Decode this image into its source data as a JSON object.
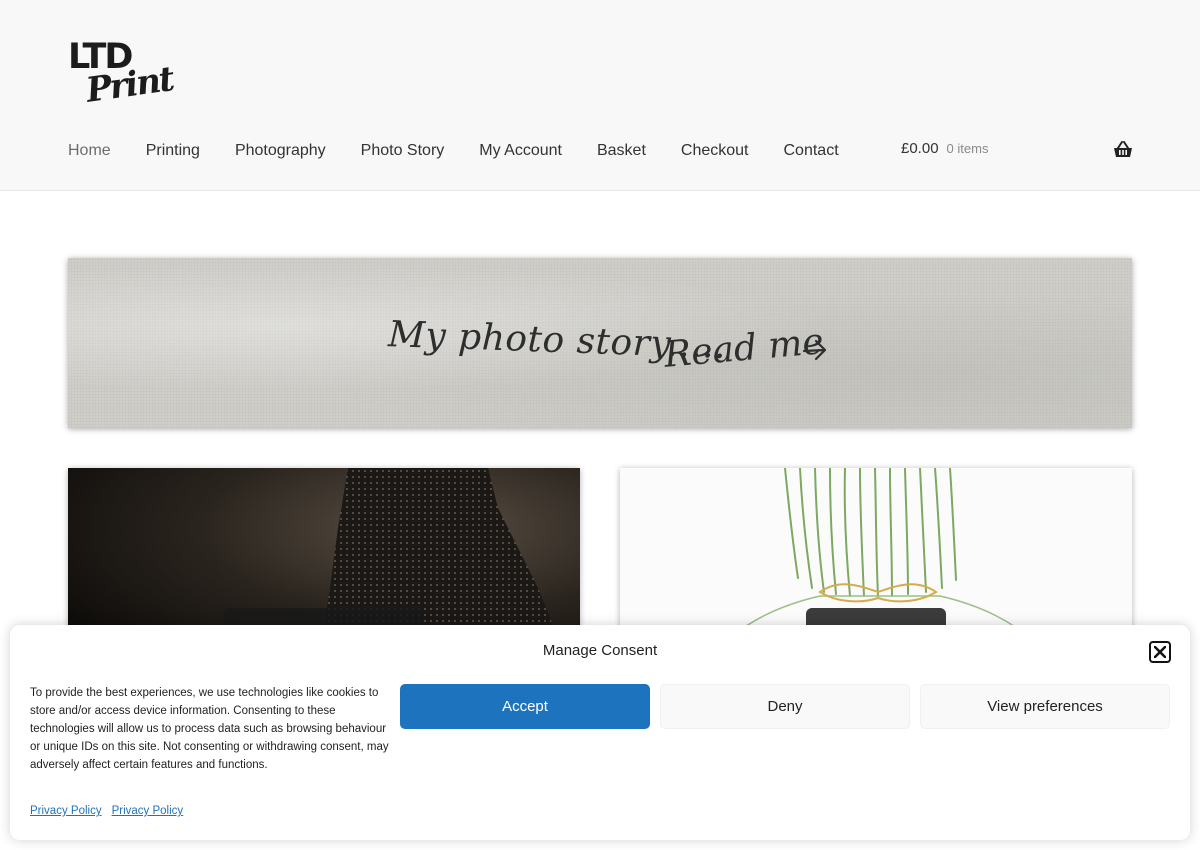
{
  "logo": {
    "line1": "LTD",
    "line2": "Print"
  },
  "nav": {
    "items": [
      {
        "label": "Home"
      },
      {
        "label": "Printing"
      },
      {
        "label": "Photography"
      },
      {
        "label": "Photo Story"
      },
      {
        "label": "My Account"
      },
      {
        "label": "Basket"
      },
      {
        "label": "Checkout"
      },
      {
        "label": "Contact"
      }
    ]
  },
  "cart": {
    "amount": "£0.00",
    "count": "0 items"
  },
  "banner": {
    "text": "My photo story.....",
    "cta": "Read me"
  },
  "consent": {
    "title": "Manage Consent",
    "body": "To provide the best experiences, we use technologies like cookies to store and/or access device information. Consenting to these technologies will allow us to process data such as browsing behaviour or unique IDs on this site. Not consenting or withdrawing consent, may adversely affect certain features and functions.",
    "accept_label": "Accept",
    "deny_label": "Deny",
    "prefs_label": "View preferences",
    "links": [
      "Privacy Policy",
      "Privacy Policy"
    ]
  },
  "colors": {
    "accent": "#1e73be",
    "header_bg": "#f8f8f8"
  }
}
